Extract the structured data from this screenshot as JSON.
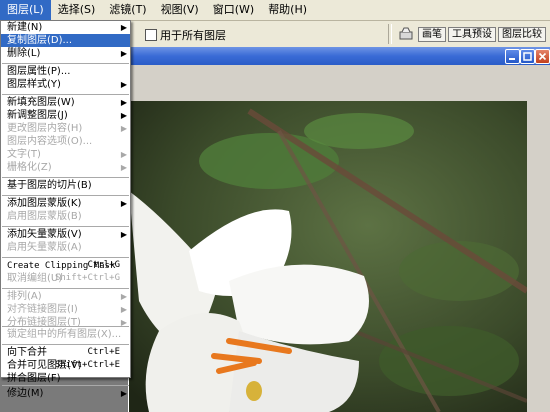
{
  "menubar": {
    "items": [
      {
        "label": "图层(L)"
      },
      {
        "label": "选择(S)"
      },
      {
        "label": "滤镜(T)"
      },
      {
        "label": "视图(V)"
      },
      {
        "label": "窗口(W)"
      },
      {
        "label": "帮助(H)"
      }
    ]
  },
  "options": {
    "sample_all_layers": "用于所有图层",
    "palette_tabs": [
      "画笔",
      "工具预设",
      "图层比较"
    ]
  },
  "layer_menu": {
    "items": [
      {
        "label": "新建(N)",
        "state": "normal",
        "submenu": true,
        "shortcut": ""
      },
      {
        "label": "复制图层(D)...",
        "state": "selected",
        "submenu": false,
        "shortcut": ""
      },
      {
        "label": "删除(L)",
        "state": "normal",
        "submenu": true,
        "shortcut": ""
      },
      {
        "label": "图层属性(P)...",
        "state": "normal",
        "submenu": false,
        "shortcut": ""
      },
      {
        "label": "图层样式(Y)",
        "state": "normal",
        "submenu": true,
        "shortcut": ""
      },
      {
        "label": "新填充图层(W)",
        "state": "normal",
        "submenu": true,
        "shortcut": ""
      },
      {
        "label": "新调整图层(J)",
        "state": "normal",
        "submenu": true,
        "shortcut": ""
      },
      {
        "label": "更改图层内容(H)",
        "state": "disabled",
        "submenu": true,
        "shortcut": ""
      },
      {
        "label": "图层内容选项(O)...",
        "state": "disabled",
        "submenu": false,
        "shortcut": ""
      },
      {
        "label": "文字(T)",
        "state": "disabled",
        "submenu": true,
        "shortcut": ""
      },
      {
        "label": "栅格化(Z)",
        "state": "disabled",
        "submenu": true,
        "shortcut": ""
      },
      {
        "label": "基于图层的切片(B)",
        "state": "normal",
        "submenu": false,
        "shortcut": ""
      },
      {
        "label": "添加图层蒙版(K)",
        "state": "normal",
        "submenu": true,
        "shortcut": ""
      },
      {
        "label": "启用图层蒙版(B)",
        "state": "disabled",
        "submenu": false,
        "shortcut": ""
      },
      {
        "label": "添加矢量蒙版(V)",
        "state": "normal",
        "submenu": true,
        "shortcut": ""
      },
      {
        "label": "启用矢量蒙版(A)",
        "state": "disabled",
        "submenu": false,
        "shortcut": ""
      },
      {
        "label": "Create Clipping Mask",
        "state": "normal",
        "submenu": false,
        "shortcut": "Ctrl+G"
      },
      {
        "label": "取消编组(U)",
        "state": "disabled",
        "submenu": false,
        "shortcut": "Shift+Ctrl+G"
      },
      {
        "label": "排列(A)",
        "state": "disabled",
        "submenu": true,
        "shortcut": ""
      },
      {
        "label": "对齐链接图层(I)",
        "state": "disabled",
        "submenu": true,
        "shortcut": ""
      },
      {
        "label": "分布链接图层(T)",
        "state": "disabled",
        "submenu": true,
        "shortcut": ""
      },
      {
        "label": "锁定组中的所有图层(X)...",
        "state": "disabled",
        "submenu": false,
        "shortcut": ""
      },
      {
        "label": "向下合并",
        "state": "normal",
        "submenu": false,
        "shortcut": "Ctrl+E"
      },
      {
        "label": "合并可见图层(V)",
        "state": "normal",
        "submenu": false,
        "shortcut": "Shift+Ctrl+E"
      },
      {
        "label": "拼合图层(F)",
        "state": "normal",
        "submenu": false,
        "shortcut": ""
      },
      {
        "label": "修边(M)",
        "state": "normal",
        "submenu": true,
        "shortcut": ""
      }
    ]
  }
}
